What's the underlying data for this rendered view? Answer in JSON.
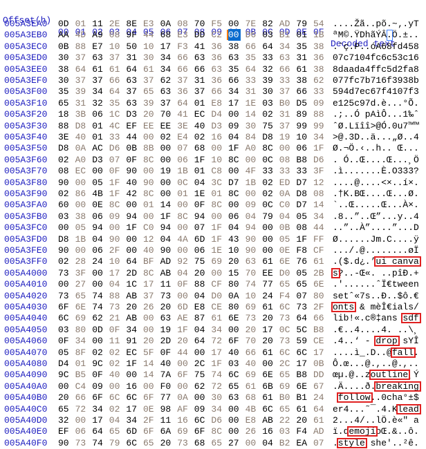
{
  "header": {
    "offset_label": "Offset(h)",
    "columns": [
      "00",
      "01",
      "02",
      "03",
      "04",
      "05",
      "06",
      "07",
      "08",
      "09",
      "0A",
      "0B",
      "0C",
      "0D",
      "0E",
      "0F"
    ],
    "decoded_label": "Decoded text"
  },
  "colors": {
    "offset": "#2020c0",
    "byte_dark": "#000000",
    "byte_light": "#8a7a6e",
    "selection": "#0a6ccf",
    "caret": "#ff7a00",
    "highlight_box": "#e02020"
  },
  "selection": {
    "row": 1,
    "col": 10
  },
  "rows": [
    {
      "offset": "005A3EA0",
      "bytes": [
        "0D",
        "01",
        "11",
        "2E",
        "8E",
        "E3",
        "0A",
        "08",
        "70",
        "F5",
        "00",
        "7E",
        "82",
        "AD",
        "79",
        "54"
      ],
      "decoded": "....Žã..põ.~‚.yT"
    },
    {
      "offset": "005A3EB0",
      "bytes": [
        "AA",
        "4D",
        "A9",
        "08",
        "9F",
        "44",
        "68",
        "E3",
        "DD",
        "C2",
        "00",
        "D6",
        "03",
        "B1",
        "01",
        "1B"
      ],
      "decoded": "ªM©.ŸDhãÝÂ.Ö.±.."
    },
    {
      "offset": "005A3EC0",
      "bytes": [
        "0B",
        "88",
        "E7",
        "10",
        "50",
        "10",
        "17",
        "F3",
        "41",
        "36",
        "38",
        "66",
        "64",
        "34",
        "35",
        "38"
      ],
      "decoded": ".ˆç.P..óA68fd458"
    },
    {
      "offset": "005A3ED0",
      "bytes": [
        "30",
        "37",
        "63",
        "37",
        "31",
        "30",
        "34",
        "66",
        "63",
        "36",
        "63",
        "35",
        "33",
        "63",
        "31",
        "36"
      ],
      "decoded": "07c7104fc6c53c16"
    },
    {
      "offset": "005A3EE0",
      "bytes": [
        "38",
        "64",
        "61",
        "61",
        "64",
        "61",
        "34",
        "66",
        "66",
        "63",
        "35",
        "64",
        "32",
        "66",
        "61",
        "38"
      ],
      "decoded": "8daada4ffc5d2fa8"
    },
    {
      "offset": "005A3EF0",
      "bytes": [
        "30",
        "37",
        "37",
        "66",
        "63",
        "37",
        "62",
        "37",
        "31",
        "36",
        "66",
        "33",
        "39",
        "33",
        "38",
        "62"
      ],
      "decoded": "077fc7b716f3938b"
    },
    {
      "offset": "005A3F00",
      "bytes": [
        "35",
        "39",
        "34",
        "64",
        "37",
        "65",
        "63",
        "36",
        "37",
        "66",
        "34",
        "31",
        "30",
        "37",
        "66",
        "33"
      ],
      "decoded": "594d7ec67f4107f3"
    },
    {
      "offset": "005A3F10",
      "bytes": [
        "65",
        "31",
        "32",
        "35",
        "63",
        "39",
        "37",
        "64",
        "01",
        "E8",
        "17",
        "1E",
        "03",
        "B0",
        "D5",
        "09"
      ],
      "decoded": "e125c97d.è...°Õ."
    },
    {
      "offset": "005A3F20",
      "bytes": [
        "18",
        "3B",
        "06",
        "1C",
        "D3",
        "20",
        "70",
        "41",
        "EC",
        "D4",
        "00",
        "14",
        "02",
        "31",
        "89",
        "88"
      ],
      "decoded": ".;..Ó pAìÔ...1‰ˆ"
    },
    {
      "offset": "005A3F30",
      "bytes": [
        "88",
        "D8",
        "01",
        "4C",
        "EF",
        "EE",
        "EE",
        "3E",
        "40",
        "D3",
        "09",
        "30",
        "75",
        "37",
        "99",
        "99"
      ],
      "decoded": "ˆØ.Lïîî>@Ó.0u7™™"
    },
    {
      "offset": "005A3F40",
      "bytes": [
        "3E",
        "40",
        "01",
        "33",
        "44",
        "00",
        "02",
        "E4",
        "02",
        "16",
        "04",
        "84",
        "D8",
        "19",
        "10",
        "34"
      ],
      "decoded": ">@.3D..ä...„Ø..4"
    },
    {
      "offset": "005A3F50",
      "bytes": [
        "D8",
        "0A",
        "AC",
        "D6",
        "0B",
        "8B",
        "00",
        "07",
        "68",
        "00",
        "1F",
        "A0",
        "8C",
        "00",
        "06",
        "1F"
      ],
      "decoded": "Ø.¬Ö.‹..h.. Œ..."
    },
    {
      "offset": "005A3F60",
      "bytes": [
        "02",
        "A0",
        "D3",
        "07",
        "0F",
        "8C",
        "00",
        "06",
        "1F",
        "10",
        "8C",
        "00",
        "0C",
        "08",
        "B8",
        "D6"
      ],
      "decoded": ". Ó..Œ....Œ...¸Ö"
    },
    {
      "offset": "005A3F70",
      "bytes": [
        "08",
        "EC",
        "00",
        "0F",
        "90",
        "00",
        "19",
        "1B",
        "01",
        "C8",
        "00",
        "4F",
        "33",
        "33",
        "33",
        "3F"
      ],
      "decoded": ".ì.......È.O333?"
    },
    {
      "offset": "005A3F80",
      "bytes": [
        "90",
        "00",
        "05",
        "1F",
        "40",
        "90",
        "00",
        "0C",
        "04",
        "3C",
        "D7",
        "1B",
        "02",
        "ED",
        "D7",
        "12"
      ],
      "decoded": "....@....<×..í×."
    },
    {
      "offset": "005A3F90",
      "bytes": [
        "02",
        "86",
        "4B",
        "1F",
        "42",
        "8C",
        "00",
        "01",
        "1E",
        "01",
        "8C",
        "00",
        "02",
        "0A",
        "D8",
        "08"
      ],
      "decoded": ".†K.BŒ....Œ...Ø."
    },
    {
      "offset": "005A3FA0",
      "bytes": [
        "60",
        "00",
        "0E",
        "8C",
        "00",
        "01",
        "14",
        "00",
        "0F",
        "8C",
        "00",
        "09",
        "0C",
        "C0",
        "D7",
        "14"
      ],
      "decoded": "`..Œ.....Œ...À×."
    },
    {
      "offset": "005A3FB0",
      "bytes": [
        "03",
        "38",
        "06",
        "09",
        "94",
        "00",
        "1F",
        "8C",
        "94",
        "00",
        "06",
        "04",
        "79",
        "04",
        "05",
        "34"
      ],
      "decoded": ".8..”..Œ”...y..4"
    },
    {
      "offset": "005A3FC0",
      "bytes": [
        "00",
        "05",
        "94",
        "00",
        "1F",
        "C0",
        "94",
        "00",
        "07",
        "1F",
        "04",
        "94",
        "00",
        "0B",
        "08",
        "44"
      ],
      "decoded": "..”..À”....”...D"
    },
    {
      "offset": "005A3FD0",
      "bytes": [
        "D8",
        "1B",
        "04",
        "90",
        "00",
        "12",
        "04",
        "4A",
        "6D",
        "1F",
        "43",
        "90",
        "00",
        "05",
        "1F",
        "FF"
      ],
      "decoded": "Ø......Jm.C....ÿ"
    },
    {
      "offset": "005A3FE0",
      "bytes": [
        "90",
        "00",
        "06",
        "2F",
        "00",
        "40",
        "90",
        "00",
        "06",
        "1E",
        "10",
        "90",
        "00",
        "0E",
        "F8",
        "CF"
      ],
      "decoded": ".../.@........øÏ"
    },
    {
      "offset": "005A3FF0",
      "bytes": [
        "02",
        "28",
        "24",
        "10",
        "64",
        "BF",
        "AD",
        "92",
        "75",
        "69",
        "20",
        "63",
        "61",
        "6E",
        "76",
        "61"
      ],
      "decoded": ".($.d¿.’ui canva"
    },
    {
      "offset": "005A4000",
      "bytes": [
        "73",
        "3F",
        "00",
        "17",
        "2D",
        "8C",
        "AB",
        "04",
        "20",
        "00",
        "15",
        "70",
        "EE",
        "D0",
        "05",
        "2B"
      ],
      "decoded": "s?..-Œ«. ..pîÐ.+"
    },
    {
      "offset": "005A4010",
      "bytes": [
        "00",
        "27",
        "00",
        "04",
        "1C",
        "17",
        "11",
        "0F",
        "88",
        "CF",
        "80",
        "74",
        "77",
        "65",
        "65",
        "6E"
      ],
      "decoded": ".'......ˆÏ€tween"
    },
    {
      "offset": "005A4020",
      "bytes": [
        "73",
        "65",
        "74",
        "88",
        "AB",
        "37",
        "73",
        "00",
        "04",
        "D0",
        "0A",
        "10",
        "24",
        "F4",
        "07",
        "80"
      ],
      "decoded": "setˆ«7s..Ð..$ô.€"
    },
    {
      "offset": "005A4030",
      "bytes": [
        "6F",
        "6E",
        "74",
        "73",
        "20",
        "26",
        "20",
        "6D",
        "E8",
        "CE",
        "80",
        "69",
        "61",
        "6C",
        "73",
        "2F"
      ],
      "decoded": "onts & mèÎ€ials/"
    },
    {
      "offset": "005A4040",
      "bytes": [
        "6C",
        "69",
        "62",
        "21",
        "AB",
        "00",
        "63",
        "AE",
        "87",
        "61",
        "6E",
        "73",
        "20",
        "73",
        "64",
        "66"
      ],
      "decoded": "lib!«.c®‡ans sdf"
    },
    {
      "offset": "005A4050",
      "bytes": [
        "03",
        "80",
        "0D",
        "0F",
        "34",
        "00",
        "19",
        "1F",
        "04",
        "34",
        "00",
        "20",
        "17",
        "0C",
        "5C",
        "B8"
      ],
      "decoded": ".€..4....4. ..\\¸"
    },
    {
      "offset": "005A4060",
      "bytes": [
        "0F",
        "34",
        "00",
        "11",
        "91",
        "20",
        "2D",
        "20",
        "64",
        "72",
        "6F",
        "70",
        "20",
        "73",
        "59",
        "CE"
      ],
      "decoded": ".4..‘ - drop sYÎ"
    },
    {
      "offset": "005A4070",
      "bytes": [
        "05",
        "8F",
        "02",
        "02",
        "EC",
        "5F",
        "0F",
        "44",
        "00",
        "17",
        "40",
        "66",
        "61",
        "6C",
        "6C",
        "17"
      ],
      "decoded": "....ì_.D..@fall."
    },
    {
      "offset": "005A4080",
      "bytes": [
        "D4",
        "01",
        "9C",
        "02",
        "1F",
        "14",
        "40",
        "00",
        "2C",
        "1F",
        "03",
        "40",
        "00",
        "2C",
        "17",
        "0B"
      ],
      "decoded": "Ô.œ...@.,..@.,.."
    },
    {
      "offset": "005A4090",
      "bytes": [
        "9C",
        "B5",
        "0F",
        "40",
        "00",
        "14",
        "7A",
        "6F",
        "75",
        "74",
        "6C",
        "69",
        "6E",
        "65",
        "B8",
        "DD"
      ],
      "decoded": "œµ.@..zoutline¸Ý"
    },
    {
      "offset": "005A40A0",
      "bytes": [
        "00",
        "C4",
        "09",
        "00",
        "16",
        "00",
        "F0",
        "00",
        "62",
        "72",
        "65",
        "61",
        "6B",
        "69",
        "6E",
        "67"
      ],
      "decoded": ".Ä....ð.breaking"
    },
    {
      "offset": "005A40B0",
      "bytes": [
        "20",
        "66",
        "6F",
        "6C",
        "6C",
        "6F",
        "77",
        "0A",
        "00",
        "30",
        "63",
        "68",
        "61",
        "B0",
        "B1",
        "24"
      ],
      "decoded": " follow..0cha°±$"
    },
    {
      "offset": "005A40C0",
      "bytes": [
        "65",
        "72",
        "34",
        "02",
        "17",
        "0E",
        "98",
        "AF",
        "09",
        "34",
        "00",
        "4B",
        "6C",
        "65",
        "61",
        "64"
      ],
      "decoded": "er4...˜¯.4.Klead"
    },
    {
      "offset": "005A40D0",
      "bytes": [
        "32",
        "00",
        "17",
        "04",
        "34",
        "2F",
        "11",
        "16",
        "6C",
        "D6",
        "00",
        "E8",
        "AB",
        "22",
        "20",
        "61"
      ],
      "decoded": "2...4/..lÖ.è«\" a"
    },
    {
      "offset": "005A40E0",
      "bytes": [
        "EF",
        "06",
        "64",
        "65",
        "6D",
        "6F",
        "6A",
        "69",
        "6F",
        "8C",
        "00",
        "26",
        "16",
        "03",
        "F4",
        "AD"
      ],
      "decoded": "ï.demojioŒ.&..ô."
    },
    {
      "offset": "005A40F0",
      "bytes": [
        "90",
        "73",
        "74",
        "79",
        "6C",
        "65",
        "20",
        "73",
        "68",
        "65",
        "27",
        "00",
        "04",
        "B2",
        "EA",
        "07"
      ],
      "decoded": ".style she'..²ê."
    }
  ],
  "highlights": [
    {
      "row": 21,
      "start": 8,
      "len": 8,
      "label": "ui canva"
    },
    {
      "row": 22,
      "start": 0,
      "len": 1,
      "label": "s"
    },
    {
      "row": 25,
      "start": 0,
      "len": 4,
      "label": "onts"
    },
    {
      "row": 26,
      "start": 13,
      "len": 3,
      "label": "sdf"
    },
    {
      "row": 28,
      "start": 8,
      "len": 4,
      "label": "drop"
    },
    {
      "row": 29,
      "start": 11,
      "len": 4,
      "label": "fall"
    },
    {
      "row": 31,
      "start": 7,
      "len": 7,
      "label": "outline"
    },
    {
      "row": 32,
      "start": 8,
      "len": 8,
      "label": "breaking"
    },
    {
      "row": 33,
      "start": 1,
      "len": 6,
      "label": "follow"
    },
    {
      "row": 34,
      "start": 12,
      "len": 4,
      "label": "lead"
    },
    {
      "row": 36,
      "start": 3,
      "len": 5,
      "label": "emoji"
    },
    {
      "row": 37,
      "start": 1,
      "len": 5,
      "label": "style"
    }
  ]
}
